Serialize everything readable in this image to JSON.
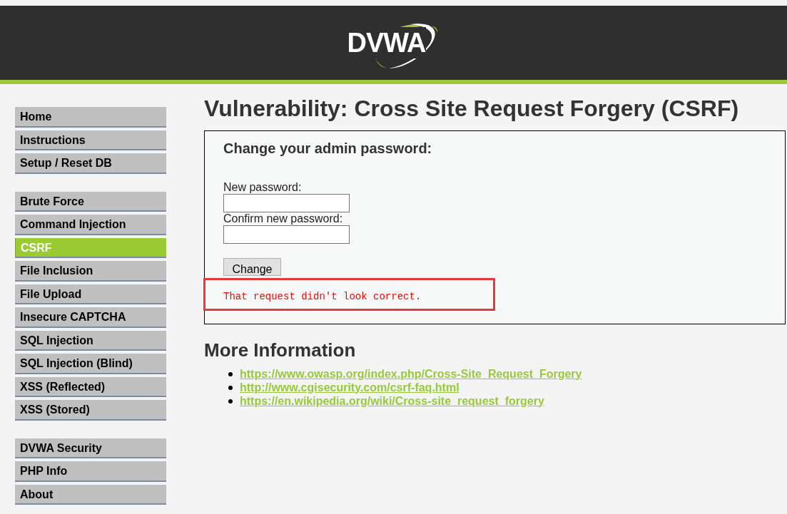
{
  "header": {
    "logo_text": "DVWA"
  },
  "menu": {
    "groups": [
      {
        "items": [
          {
            "label": "Home",
            "selected": false
          },
          {
            "label": "Instructions",
            "selected": false
          },
          {
            "label": "Setup / Reset DB",
            "selected": false
          }
        ]
      },
      {
        "items": [
          {
            "label": "Brute Force",
            "selected": false
          },
          {
            "label": "Command Injection",
            "selected": false
          },
          {
            "label": "CSRF",
            "selected": true
          },
          {
            "label": "File Inclusion",
            "selected": false
          },
          {
            "label": "File Upload",
            "selected": false
          },
          {
            "label": "Insecure CAPTCHA",
            "selected": false
          },
          {
            "label": "SQL Injection",
            "selected": false
          },
          {
            "label": "SQL Injection (Blind)",
            "selected": false
          },
          {
            "label": "XSS (Reflected)",
            "selected": false
          },
          {
            "label": "XSS (Stored)",
            "selected": false
          }
        ]
      },
      {
        "items": [
          {
            "label": "DVWA Security",
            "selected": false
          },
          {
            "label": "PHP Info",
            "selected": false
          },
          {
            "label": "About",
            "selected": false
          }
        ]
      }
    ]
  },
  "page_title": "Vulnerability: Cross Site Request Forgery (CSRF)",
  "form": {
    "title": "Change your admin password:",
    "fields": [
      {
        "label": "New password:"
      },
      {
        "label": "Confirm new password:"
      }
    ],
    "button": "Change",
    "message": "That request didn't look correct."
  },
  "more_info": {
    "title": "More Information",
    "links": [
      "https://www.owasp.org/index.php/Cross-Site_Request_Forgery",
      "http://www.cgisecurity.com/csrf-faq.html",
      "https://en.wikipedia.org/wiki/Cross-site_request_forgery"
    ]
  }
}
